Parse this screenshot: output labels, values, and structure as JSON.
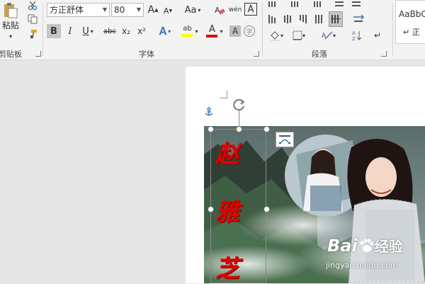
{
  "ribbon": {
    "clipboard": {
      "paste_label": "粘贴",
      "group_label": "剪贴板"
    },
    "font": {
      "font_name": "方正舒体",
      "font_size": "80",
      "grow_label": "A",
      "shrink_label": "A",
      "case_label": "Aa",
      "bold": "B",
      "italic": "I",
      "underline": "U",
      "strike": "abc",
      "subscript": "x₂",
      "superscript": "x²",
      "effects": "A",
      "highlight": "ab",
      "font_color": "A",
      "enclose": "字",
      "border_char": "A",
      "group_label": "字体"
    },
    "paragraph": {
      "group_label": "段落"
    },
    "styles": {
      "preview": "AaBbC",
      "name": "↵ 正"
    }
  },
  "document": {
    "title_chars": [
      "赵",
      "雅",
      "芝"
    ],
    "watermark_main": "Bai",
    "watermark_jingyan": "经验",
    "watermark_url": "jingyan.baidu.com"
  },
  "colors": {
    "highlight": "#ffff00",
    "font_color": "#e00000",
    "title_text": "#e00000",
    "selected_button": "#c5c5c5"
  }
}
